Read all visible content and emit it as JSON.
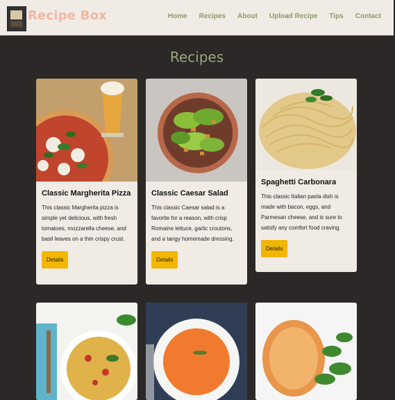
{
  "brand": {
    "name": "Recipe Box"
  },
  "nav": {
    "items": [
      "Home",
      "Recipes",
      "About",
      "Upload Recipe",
      "Tips",
      "Contact"
    ]
  },
  "page": {
    "title": "Recipes"
  },
  "recipes": [
    {
      "title": "Classic Margherita Pizza",
      "description": "This classic Margherita pizza is simple yet delicious, with fresh tomatoes, mozzarella cheese, and basil leaves on a thin crispy crust.",
      "button": "Details"
    },
    {
      "title": "Classic Caesar Salad",
      "description": "This classic Caesar salad is a favorite for a reason, with crisp Romaine lettuce, garlic croutons, and a tangy homemade dressing.",
      "button": "Details"
    },
    {
      "title": "Spaghetti Carbonara",
      "description": "This classic Italian pasta dish is made with bacon, eggs, and Parmesan cheese, and is sure to satisfy any comfort food craving.",
      "button": "Details"
    }
  ],
  "colors": {
    "accent": "#f3b600",
    "brand": "#f0b79f",
    "nav": "#8c9967",
    "background": "#2b2827"
  }
}
